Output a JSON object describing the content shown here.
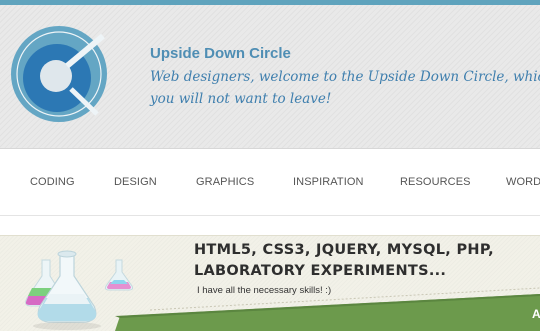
{
  "header": {
    "site_title": "Upside Down Circle",
    "tagline": "Web designers, welcome to the Upside Down Circle, which you will not want to leave!"
  },
  "logo": {
    "icon": "ring-logo-icon",
    "outer_color": "#64a6c4",
    "inner_color": "#2c78b4"
  },
  "nav": {
    "items": [
      {
        "label": "CODING"
      },
      {
        "label": "DESIGN"
      },
      {
        "label": "GRAPHICS"
      },
      {
        "label": "INSPIRATION"
      },
      {
        "label": "RESOURCES"
      },
      {
        "label": "WORD"
      }
    ]
  },
  "banner": {
    "headline_line1": "HTML5, CSS3, JQUERY, MYSQL, PHP,",
    "headline_line2": "LABORATORY EXPERIMENTS...",
    "subline": "I have all the necessary skills! :)",
    "ribbon_text": "A",
    "ribbon_color": "#6c9a4c",
    "flask_icon": "flask-icon"
  },
  "colors": {
    "accent_bar": "#5fa3bd",
    "title": "#4f8eb4",
    "tagline": "#3f7fae"
  }
}
